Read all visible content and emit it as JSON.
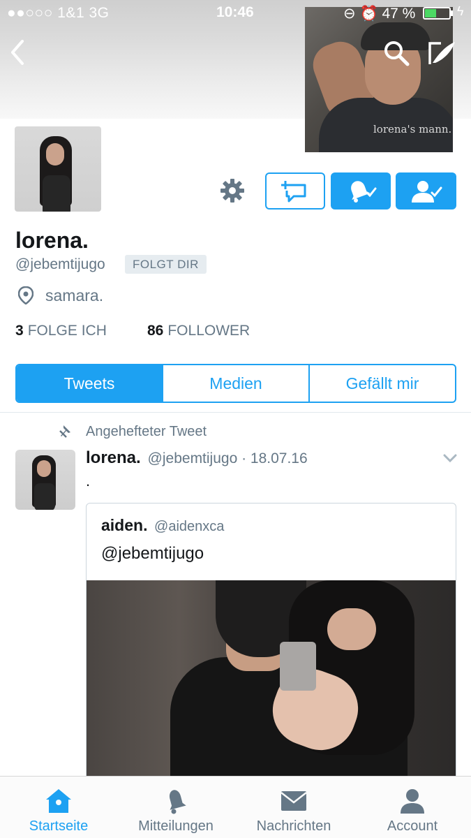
{
  "status_bar": {
    "carrier": "●●○○○ 1&1  3G",
    "time": "10:46",
    "battery_text": "47 %",
    "battery_level": 0.47
  },
  "header": {
    "photo_caption": "lorena's mann."
  },
  "profile": {
    "display_name": "lorena.",
    "handle": "@jebemtijugo",
    "follows_you_badge": "FOLGT DIR",
    "location": "samara.",
    "following_count": "3",
    "following_label": "FOLGE ICH",
    "followers_count": "86",
    "followers_label": "FOLLOWER"
  },
  "tabs": [
    {
      "label": "Tweets",
      "active": true
    },
    {
      "label": "Medien",
      "active": false
    },
    {
      "label": "Gefällt mir",
      "active": false
    }
  ],
  "tweet": {
    "pinned_label": "Angehefteter Tweet",
    "author_name": "lorena.",
    "author_meta": "@jebemtijugo · 18.07.16",
    "text": ".",
    "quote": {
      "author_name": "aiden.",
      "author_handle": "@aidenxca",
      "text": "@jebemtijugo"
    }
  },
  "tabbar": [
    {
      "label": "Startseite",
      "icon": "home-icon",
      "active": true
    },
    {
      "label": "Mitteilungen",
      "icon": "bell-icon",
      "active": false
    },
    {
      "label": "Nachrichten",
      "icon": "envelope-icon",
      "active": false
    },
    {
      "label": "Account",
      "icon": "person-icon",
      "active": false
    }
  ],
  "colors": {
    "accent": "#1da1f2",
    "secondary_text": "#657786",
    "primary_text": "#14171a"
  }
}
